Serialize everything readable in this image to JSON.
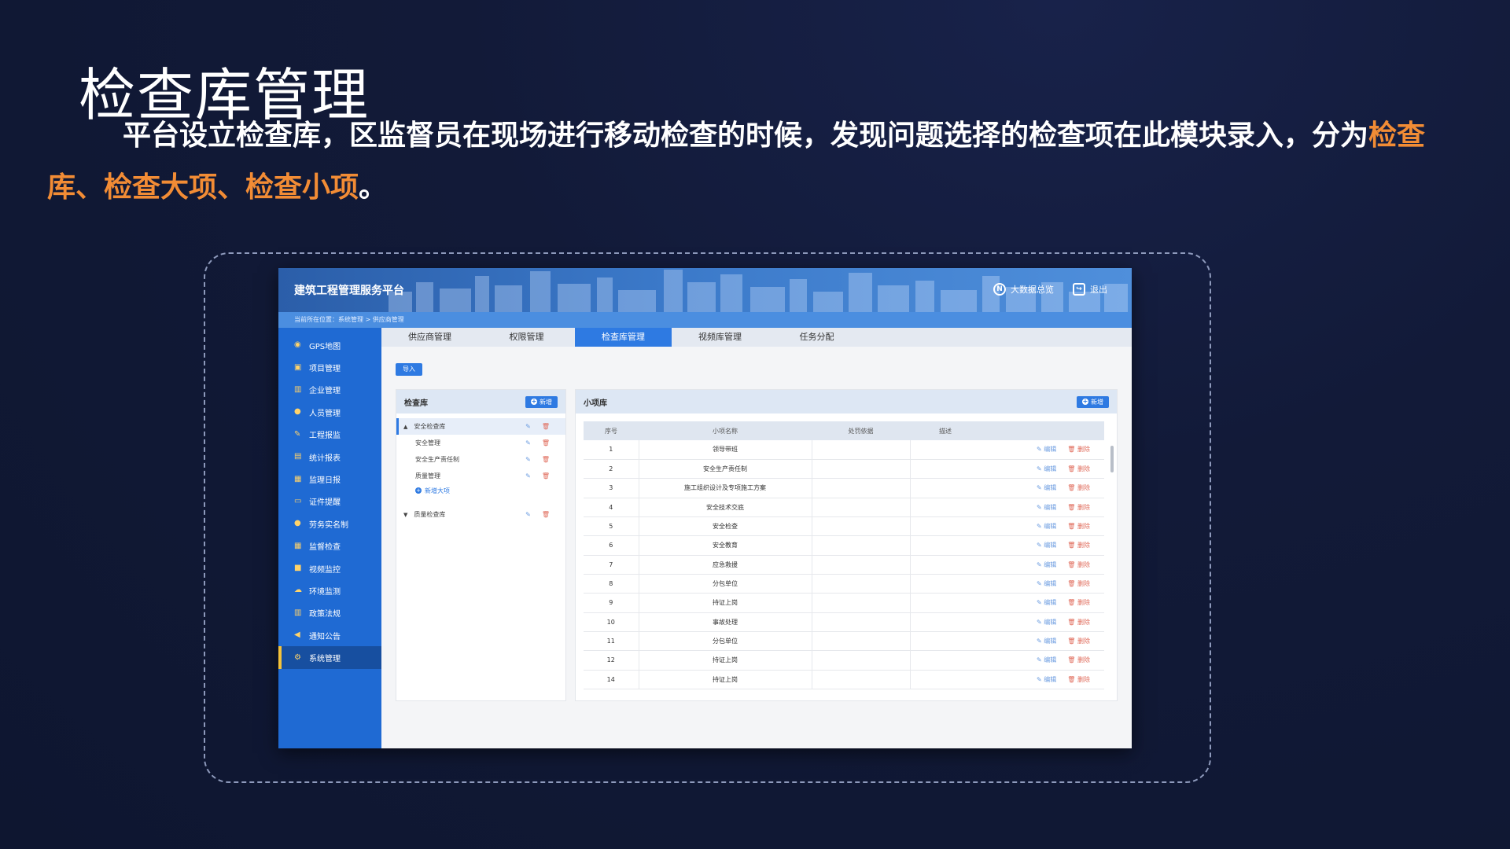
{
  "slide": {
    "title": "检查库管理",
    "desc_main": "平台设立检查库，区监督员在现场进行移动检查的时候，发现问题选择的检查项在此模块录入，分为",
    "desc_highlight": "检查库、检查大项、检查小项",
    "desc_end": "。"
  },
  "app": {
    "title": "建筑工程管理服务平台",
    "header_buttons": {
      "bigdata": "大数据总览",
      "logout": "退出"
    },
    "breadcrumb": "当前所在位置：系统管理 > 供应商管理",
    "sidebar": [
      {
        "label": "GPS地图",
        "icon": "location-pin-icon"
      },
      {
        "label": "项目管理",
        "icon": "folder-icon"
      },
      {
        "label": "企业管理",
        "icon": "building-icon"
      },
      {
        "label": "人员管理",
        "icon": "person-icon"
      },
      {
        "label": "工程报监",
        "icon": "report-icon"
      },
      {
        "label": "统计报表",
        "icon": "chart-icon"
      },
      {
        "label": "监理日报",
        "icon": "document-icon"
      },
      {
        "label": "证件提醒",
        "icon": "card-icon"
      },
      {
        "label": "劳务实名制",
        "icon": "worker-icon"
      },
      {
        "label": "监督检查",
        "icon": "grid-icon"
      },
      {
        "label": "视频监控",
        "icon": "camera-icon"
      },
      {
        "label": "环境监测",
        "icon": "cloud-icon"
      },
      {
        "label": "政策法规",
        "icon": "book-icon"
      },
      {
        "label": "通知公告",
        "icon": "speaker-icon"
      },
      {
        "label": "系统管理",
        "icon": "gear-icon",
        "active": true
      }
    ],
    "tabs": [
      "供应商管理",
      "权限管理",
      "检查库管理",
      "视频库管理",
      "任务分配"
    ],
    "active_tab": 2,
    "import_label": "导入",
    "left_panel": {
      "title": "检查库",
      "add_label": "新增",
      "tree": {
        "group1": "安全检查库",
        "children": [
          "安全管理",
          "安全生产责任制",
          "质量管理"
        ],
        "add_item": "新增大项",
        "group2": "质量检查库"
      }
    },
    "right_panel": {
      "title": "小项库",
      "add_label": "新增",
      "columns": [
        "序号",
        "小项名称",
        "处罚依据",
        "描述"
      ],
      "edit_label": "编辑",
      "delete_label": "删除",
      "rows": [
        {
          "no": "1",
          "name": "领导带班"
        },
        {
          "no": "2",
          "name": "安全生产责任制"
        },
        {
          "no": "3",
          "name": "施工组织设计及专项施工方案"
        },
        {
          "no": "4",
          "name": "安全技术交底"
        },
        {
          "no": "5",
          "name": "安全检查"
        },
        {
          "no": "6",
          "name": "安全教育"
        },
        {
          "no": "7",
          "name": "应急救援"
        },
        {
          "no": "8",
          "name": "分包单位"
        },
        {
          "no": "9",
          "name": "持证上岗"
        },
        {
          "no": "10",
          "name": "事故处理"
        },
        {
          "no": "11",
          "name": "分包单位"
        },
        {
          "no": "12",
          "name": "持证上岗"
        },
        {
          "no": "14",
          "name": "持证上岗"
        }
      ]
    }
  },
  "colors": {
    "highlight": "#f28c35",
    "primary": "#2e7ae2",
    "sidebar": "#1f6ad3",
    "active_marker": "#f5c33b"
  }
}
